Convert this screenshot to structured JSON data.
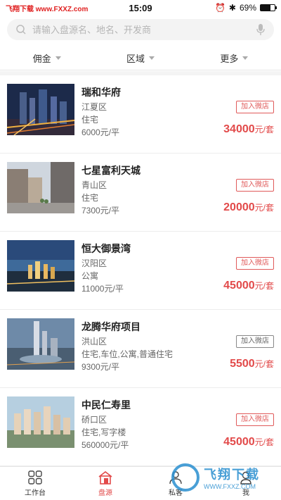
{
  "status_bar": {
    "source_label": "飞翔下载 www.FXXZ.com",
    "time": "15:09",
    "battery": "69%",
    "battery_level": 0.69
  },
  "search": {
    "placeholder": "请输入盘源名、地名、开发商"
  },
  "filters": [
    {
      "label": "佣金"
    },
    {
      "label": "区域"
    },
    {
      "label": "更多"
    }
  ],
  "listings": [
    {
      "name": "瑞和华府",
      "district": "江夏区",
      "type": "住宅",
      "unit_price": "6000元/平",
      "button": "加入微店",
      "commission": "34000",
      "commission_unit": "元/套",
      "button_active": true,
      "thumb": "night-city"
    },
    {
      "name": "七星富利天城",
      "district": "青山区",
      "type": "住宅",
      "unit_price": "7300元/平",
      "button": "加入微店",
      "commission": "20000",
      "commission_unit": "元/套",
      "button_active": true,
      "thumb": "street"
    },
    {
      "name": "恒大御景湾",
      "district": "汉阳区",
      "type": "公寓",
      "unit_price": "11000元/平",
      "button": "加入微店",
      "commission": "45000",
      "commission_unit": "元/套",
      "button_active": true,
      "thumb": "riverside"
    },
    {
      "name": "龙腾华府项目",
      "district": "洪山区",
      "type": "住宅,车位,公寓,普通住宅",
      "unit_price": "9300元/平",
      "button": "加入微店",
      "commission": "5500",
      "commission_unit": "元/套",
      "button_active": false,
      "thumb": "towers"
    },
    {
      "name": "中民仁寿里",
      "district": "硚口区",
      "type": "住宅,写字楼",
      "unit_price": "560000元/平",
      "button": "加入微店",
      "commission": "45000",
      "commission_unit": "元/套",
      "button_active": true,
      "thumb": "aerial"
    }
  ],
  "tab_bar": [
    {
      "label": "工作台",
      "icon": "grid-icon",
      "active": false
    },
    {
      "label": "盘源",
      "icon": "house-icon",
      "active": true
    },
    {
      "label": "私客",
      "icon": "person-icon",
      "active": false
    },
    {
      "label": "我",
      "icon": "me-icon",
      "active": false
    }
  ],
  "watermark": {
    "title": "飞翔下载",
    "url": "WWW.FXXZ.COM"
  },
  "colors": {
    "accent": "#e24a4a",
    "watermark": "#2a8fd0"
  }
}
